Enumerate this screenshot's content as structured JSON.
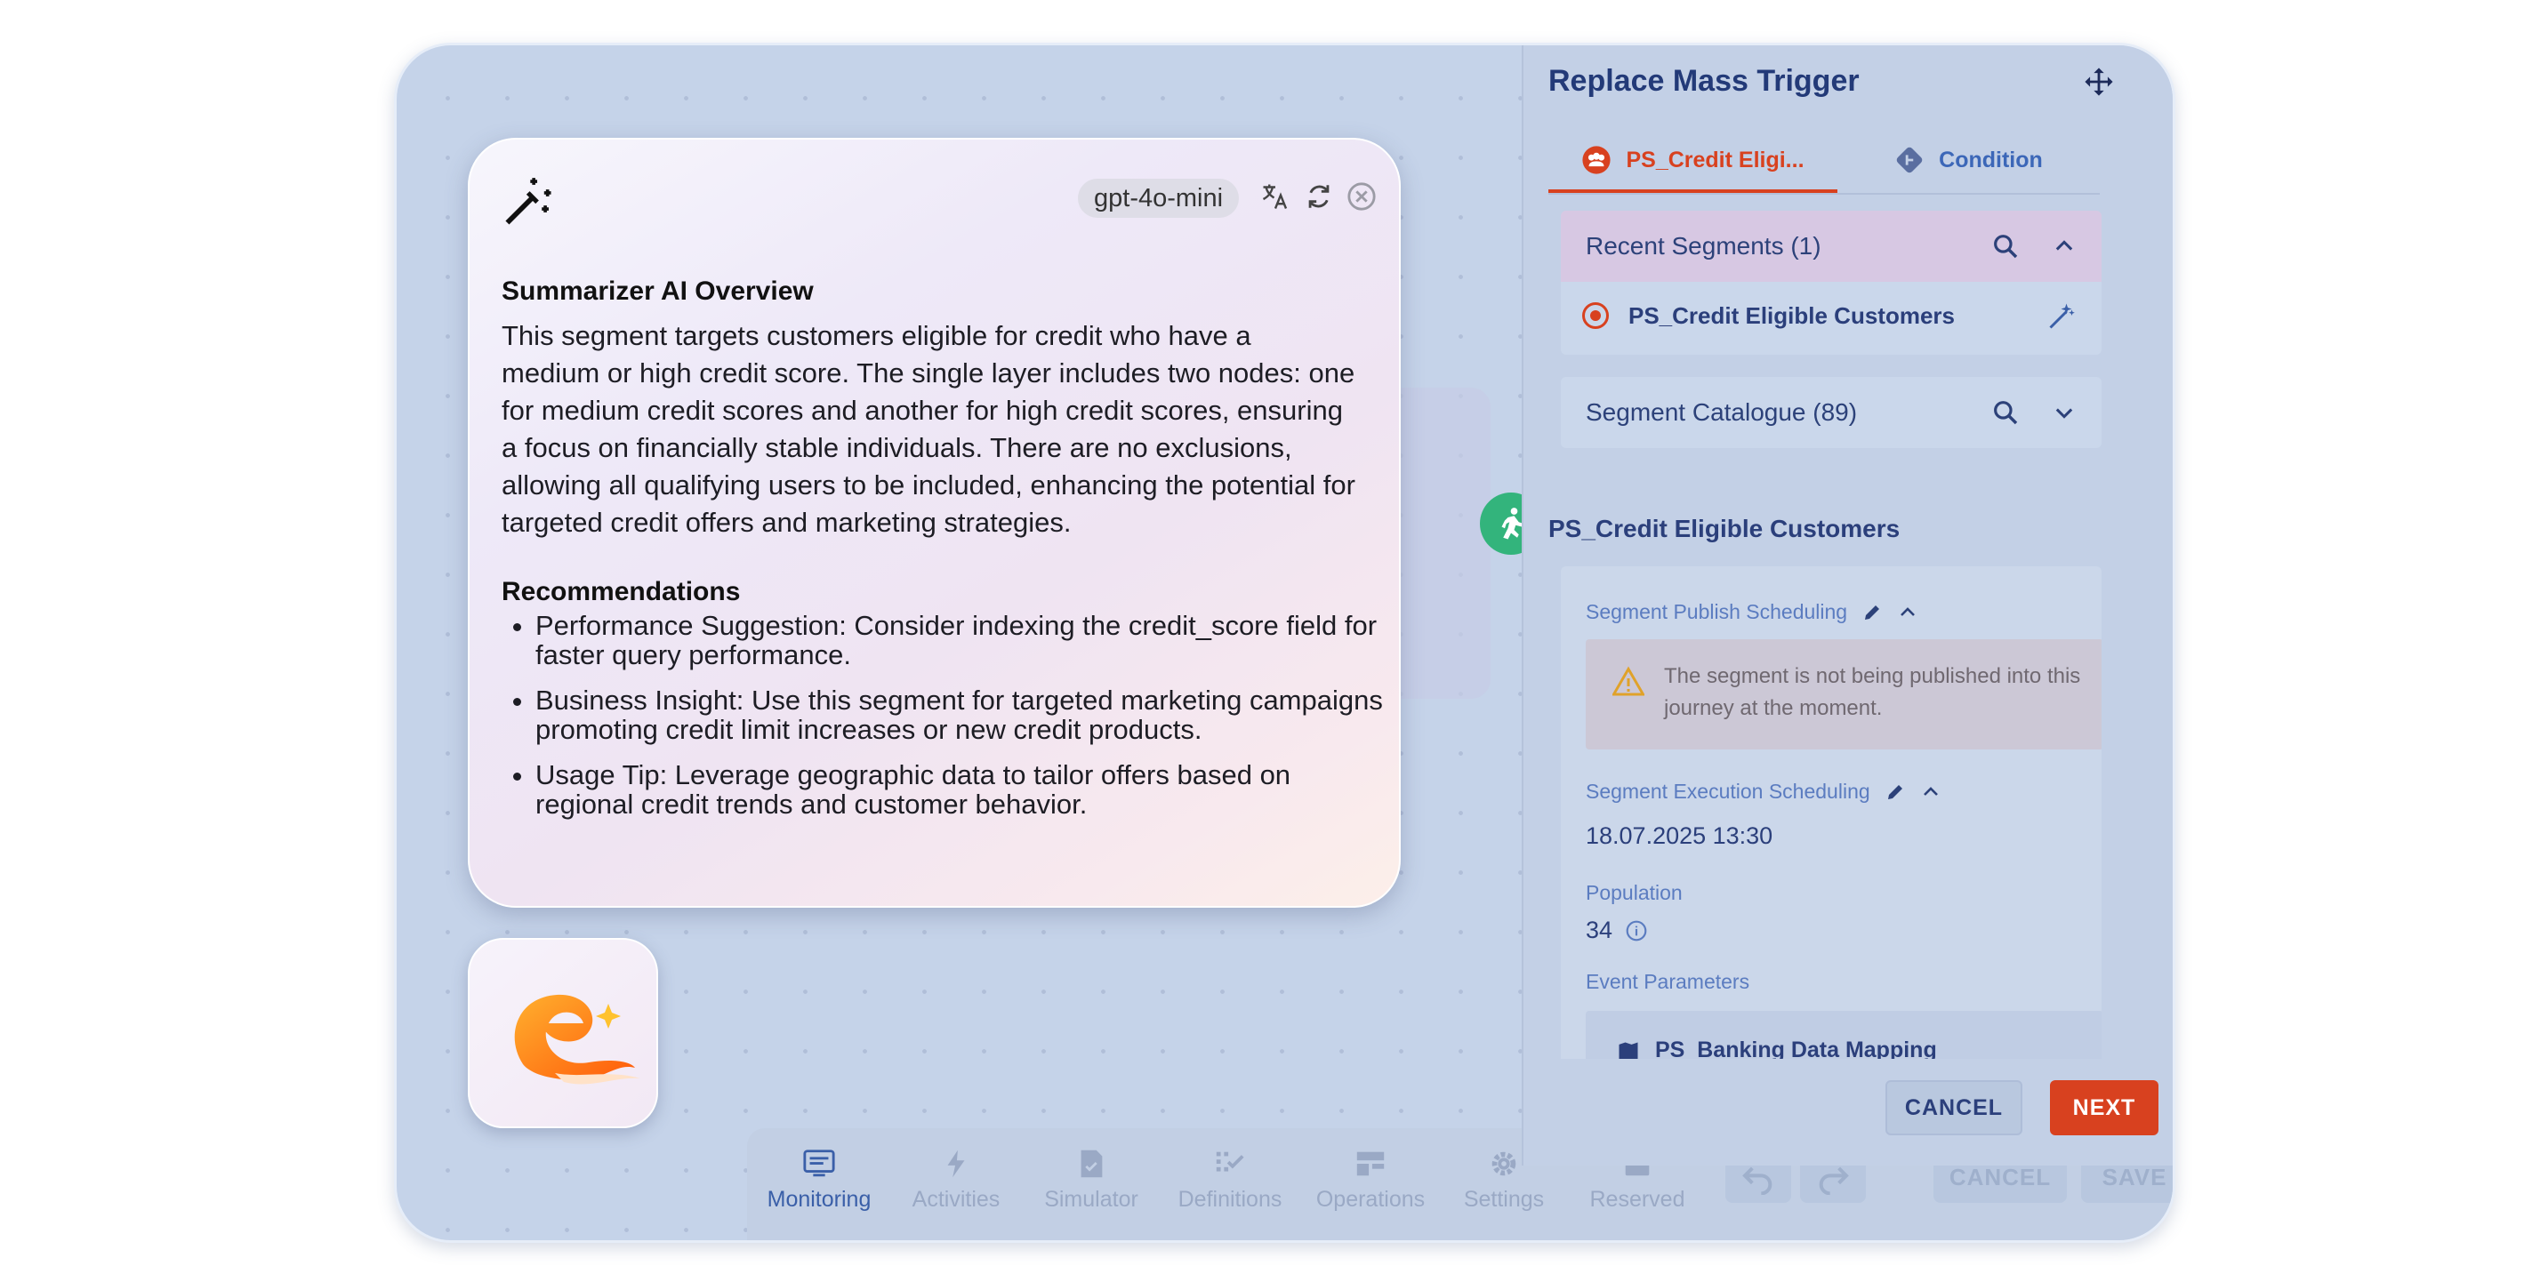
{
  "panel": {
    "title": "Replace Mass Trigger",
    "tabs": [
      {
        "label": "PS_Credit Eligi..."
      },
      {
        "label": "Condition"
      }
    ],
    "recent_segments": {
      "title": "Recent Segments (1)",
      "item": "PS_Credit Eligible Customers"
    },
    "catalogue": {
      "title": "Segment Catalogue (89)"
    },
    "selected_segment": "PS_Credit Eligible Customers",
    "publish_label": "Segment Publish Scheduling",
    "publish_warning": "The segment is not being published into this journey at the moment.",
    "execution_label": "Segment Execution Scheduling",
    "execution_value": "18.07.2025 13:30",
    "population_label": "Population",
    "population_value": "34",
    "event_params_label": "Event Parameters",
    "event_params_value": "PS_Banking Data Mapping",
    "cancel": "CANCEL",
    "next": "NEXT"
  },
  "toolbar": {
    "items": [
      "Monitoring",
      "Activities",
      "Simulator",
      "Definitions",
      "Operations",
      "Settings",
      "Reserved"
    ],
    "cancel": "CANCEL",
    "save": "SAVE"
  },
  "canvas": {
    "ghost_text": "e"
  },
  "ai": {
    "model": "gpt-4o-mini",
    "heading": "Summarizer AI Overview",
    "summary": "This segment targets customers eligible for credit who have a medium or high credit score. The single layer includes two nodes: one for medium credit scores and another for high credit scores, ensuring a focus on financially stable individuals. There are no exclusions, allowing all qualifying users to be included, enhancing the potential for targeted credit offers and marketing strategies.",
    "rec_heading": "Recommendations",
    "recommendations": [
      "Performance Suggestion: Consider indexing the credit_score field for faster query performance.",
      "Business Insight: Use this segment for targeted marketing campaigns promoting credit limit increases or new credit products.",
      "Usage Tip: Leverage geographic data to tailor offers based on regional credit trends and customer behavior."
    ]
  },
  "colors": {
    "accent": "#d8411f",
    "primary": "#233a78",
    "start_node": "#33b47c"
  }
}
